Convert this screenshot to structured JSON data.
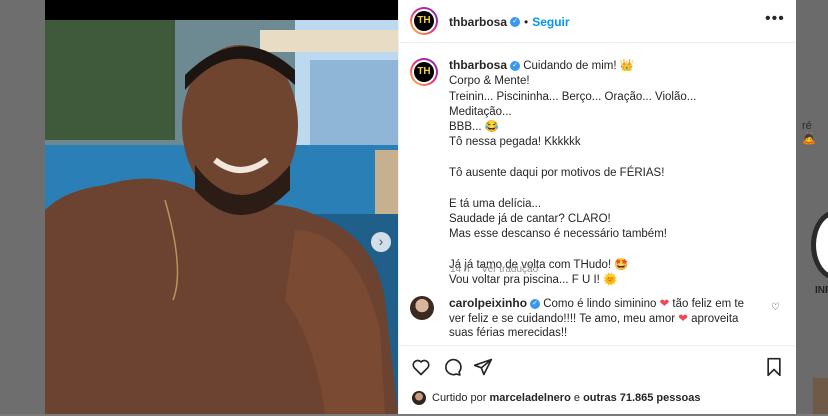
{
  "background": {
    "frag_top": "ré 🙇",
    "frag_bottom": "INF"
  },
  "post": {
    "username": "thbarbosa",
    "follow_label": "Seguir",
    "avatar_text": "TH",
    "caption": {
      "username": "thbarbosa",
      "first_line": "Cuidando de mim! 👑",
      "lines": [
        "Corpo & Mente!",
        "Treinin... Piscininha... Berço... Oração... Violão... Meditação...",
        "BBB... 😂",
        "Tô nessa pegada! Kkkkkk",
        "",
        "Tô ausente daqui por motivos de FÉRIAS!",
        "",
        "E tá uma delícia...",
        "Saudade já de cantar? CLARO!",
        "Mas esse descanso é necessário também!",
        "",
        "Já já tamo de volta com THudo! 🤩",
        "Vou voltar pra piscina... F U I! 🌞"
      ]
    },
    "time": "14 h",
    "translate_label": "Ver tradução",
    "comment": {
      "username": "carolpeixinho",
      "text_a": "Como é lindo siminino",
      "text_b": "tão feliz em te ver feliz e se cuidando!!!! Te amo, meu amor",
      "text_c": "aproveita suas férias merecidas!!"
    },
    "likes": {
      "prefix": "Curtido por",
      "user": "marceladelnero",
      "middle": "e",
      "others": "outras 71.865 pessoas"
    }
  },
  "colors": {
    "accent": "#0095f6",
    "verified": "#3897f0",
    "heart": "#ed4956"
  },
  "icons": [
    "verified-icon",
    "more-options-icon",
    "chevron-right-icon",
    "heart-icon",
    "comment-icon",
    "share-icon",
    "bookmark-icon"
  ]
}
